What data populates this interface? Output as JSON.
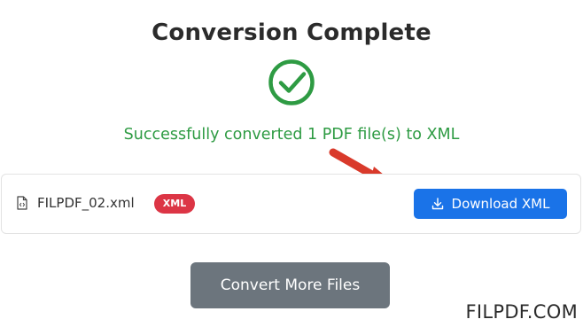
{
  "header": {
    "title": "Conversion Complete",
    "success_icon": "check-circle-icon",
    "success_message": "Successfully converted 1 PDF file(s) to XML"
  },
  "file": {
    "icon": "file-code-icon",
    "name": "FILPDF_02.xml",
    "badge": "XML",
    "download_icon": "download-icon",
    "download_label": "Download XML"
  },
  "annotation": {
    "arrow_icon": "red-arrow-icon"
  },
  "actions": {
    "convert_more_label": "Convert More Files"
  },
  "watermark": "FILPDF.COM",
  "colors": {
    "success": "#2e9b43",
    "badge": "#dc3545",
    "primary": "#1a73e8",
    "secondary": "#6c757d",
    "arrow": "#d93a2b"
  }
}
